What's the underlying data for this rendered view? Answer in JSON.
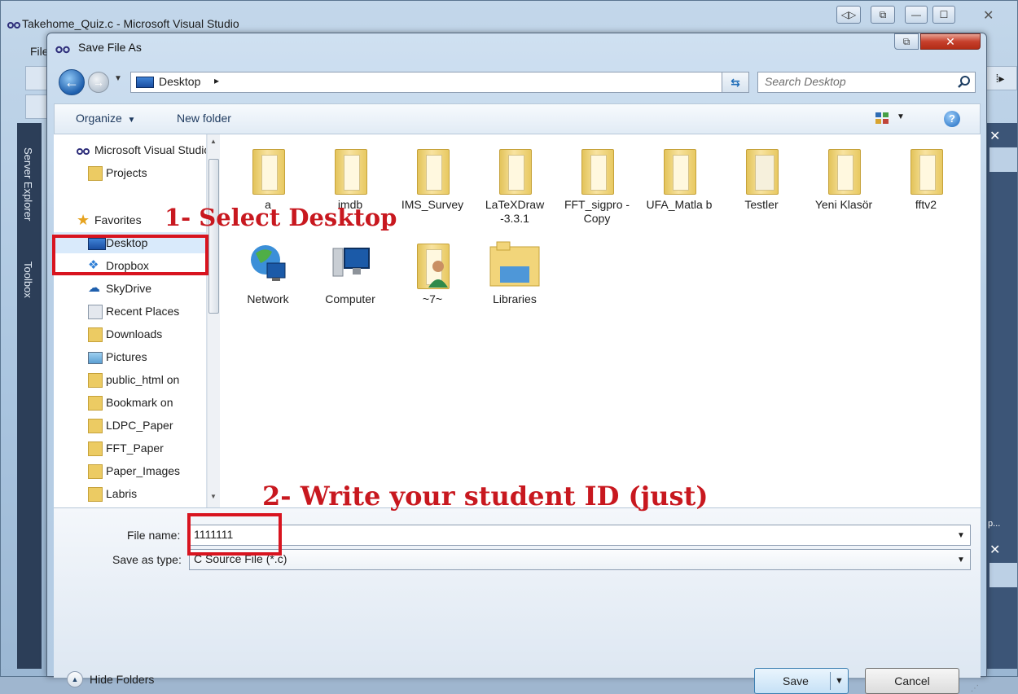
{
  "vs": {
    "title": "Takehome_Quiz.c - Microsoft Visual Studio",
    "menu_file": "File",
    "side_tab_server_explorer": "Server Explorer",
    "side_tab_toolbox": "Toolbox",
    "right_dots": "p..."
  },
  "dialog": {
    "title": "Save File As",
    "address": {
      "location": "Desktop",
      "search_placeholder": "Search Desktop"
    },
    "toolbar": {
      "organize": "Organize",
      "new_folder": "New folder"
    },
    "nav": {
      "items": [
        {
          "label": "Microsoft Visual Studio",
          "icon": "vs-logo-icon"
        },
        {
          "label": "Projects",
          "icon": "folder-icon"
        },
        {
          "label": "Favorites",
          "icon": "star-icon"
        },
        {
          "label": "Desktop",
          "icon": "desktop-icon"
        },
        {
          "label": "Dropbox",
          "icon": "dropbox-icon"
        },
        {
          "label": "SkyDrive",
          "icon": "skydrive-icon"
        },
        {
          "label": "Recent Places",
          "icon": "recent-places-icon"
        },
        {
          "label": "Downloads",
          "icon": "downloads-icon"
        },
        {
          "label": "Pictures",
          "icon": "pictures-icon"
        },
        {
          "label": "public_html on",
          "icon": "folder-icon"
        },
        {
          "label": "Bookmark on",
          "icon": "folder-icon"
        },
        {
          "label": "LDPC_Paper",
          "icon": "folder-icon"
        },
        {
          "label": "FFT_Paper",
          "icon": "folder-icon"
        },
        {
          "label": "Paper_Images",
          "icon": "folder-icon"
        },
        {
          "label": "Labris",
          "icon": "folder-icon"
        }
      ]
    },
    "files": [
      {
        "label": "a",
        "icon": "folder-icon"
      },
      {
        "label": "imdb",
        "icon": "folder-icon"
      },
      {
        "label": "IMS_Survey",
        "icon": "folder-icon"
      },
      {
        "label": "LaTeXDraw -3.3.1",
        "icon": "folder-icon"
      },
      {
        "label": "FFT_sigpro - Copy",
        "icon": "folder-icon"
      },
      {
        "label": "UFA_Matla b",
        "icon": "folder-icon"
      },
      {
        "label": "Testler",
        "icon": "folder-icon"
      },
      {
        "label": "Yeni Klasör",
        "icon": "folder-icon"
      },
      {
        "label": "fftv2",
        "icon": "folder-icon"
      },
      {
        "label": "Network",
        "icon": "network-icon"
      },
      {
        "label": "Computer",
        "icon": "computer-icon"
      },
      {
        "label": "~7~",
        "icon": "user-folder-icon"
      },
      {
        "label": "Libraries",
        "icon": "libraries-icon"
      }
    ],
    "form": {
      "file_name_label": "File name:",
      "file_name_value": "1111111",
      "save_type_label": "Save as type:",
      "save_type_value": "C Source File (*.c)"
    },
    "buttons": {
      "hide_folders": "Hide Folders",
      "save": "Save",
      "cancel": "Cancel"
    }
  },
  "annotations": {
    "step1": "1- Select Desktop",
    "step2": "2- Write your student ID (just)"
  },
  "colors": {
    "annotation_red": "#c8181f",
    "accent_blue": "#1e5fad"
  }
}
